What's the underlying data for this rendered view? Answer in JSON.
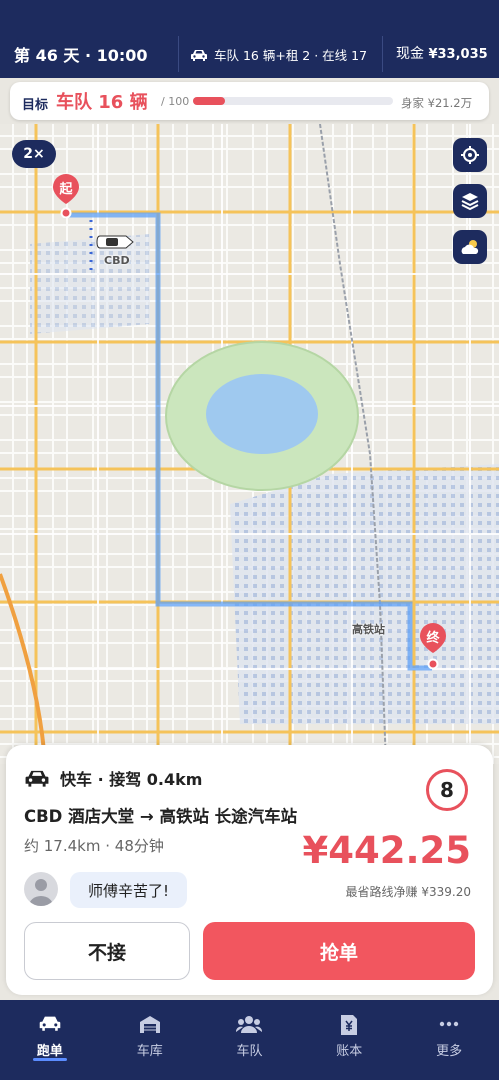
{
  "status": {
    "day_time": "第 46 天 · 10:00",
    "fleet_summary": "车队 16 辆+租 2 · 在线 17",
    "cash_label": "现金",
    "cash_value": "¥33,035"
  },
  "goal": {
    "label": "目标",
    "target": "车队 16 辆",
    "max": "/ 100",
    "progress": 0.16,
    "net_worth": "身家 ¥21.2万"
  },
  "map": {
    "zoom": "2×",
    "start_marker": "起",
    "end_marker": "终",
    "car_label": "CBD",
    "station_label": "高铁站"
  },
  "order": {
    "ride_type": "快车 · 接驾 0.4km",
    "route": "CBD 酒店大堂 → 高铁站 长途汽车站",
    "distance_time": "约 17.4km · 48分钟",
    "countdown": "8",
    "price": "¥442.25",
    "net_earning": "最省路线净赚 ¥339.20",
    "message": "师傅辛苦了!",
    "decline_label": "不接",
    "accept_label": "抢单"
  },
  "nav": [
    {
      "label": "跑单",
      "icon": "car-icon",
      "active": true
    },
    {
      "label": "车库",
      "icon": "garage-icon",
      "active": false
    },
    {
      "label": "车队",
      "icon": "team-icon",
      "active": false
    },
    {
      "label": "账本",
      "icon": "ledger-icon",
      "active": false
    },
    {
      "label": "更多",
      "icon": "more-icon",
      "active": false
    }
  ],
  "colors": {
    "navy": "#1d2b5e",
    "accent": "#e8515c",
    "route": "#5ea0f7"
  }
}
